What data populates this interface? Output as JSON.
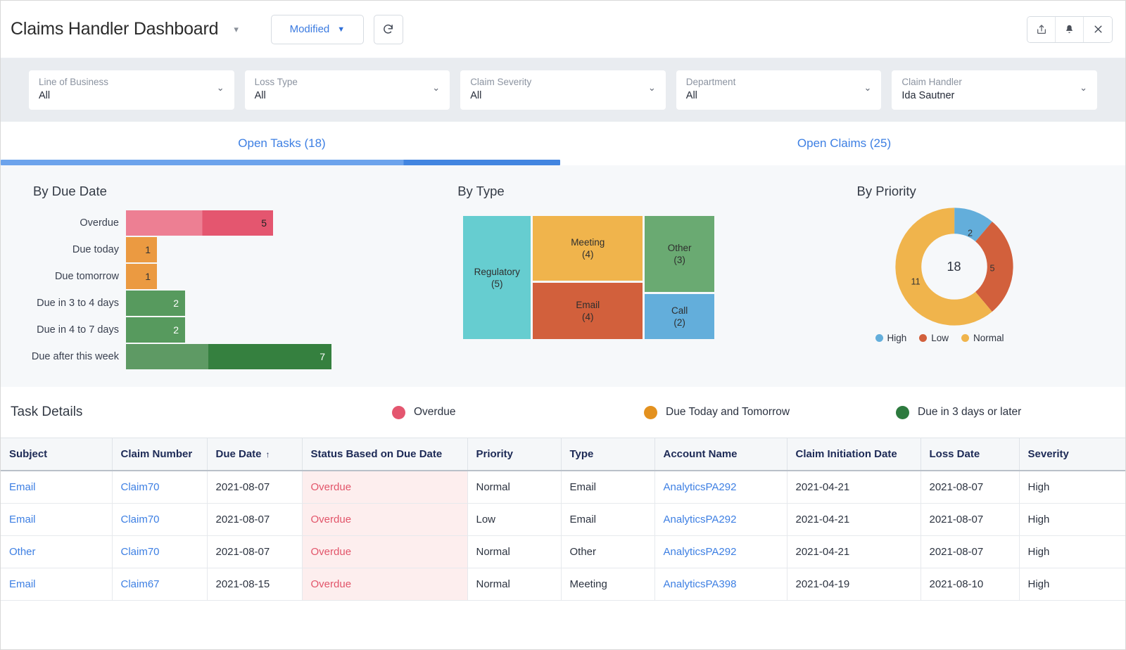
{
  "header": {
    "title": "Claims Handler Dashboard",
    "title_caret": "▾",
    "modified_label": "Modified",
    "modified_caret": "▼",
    "refresh_icon": "refresh-icon",
    "share_icon": "share-icon",
    "bell_icon": "bell-icon",
    "close_icon": "close-icon"
  },
  "filters": [
    {
      "label": "Line of Business",
      "value": "All"
    },
    {
      "label": "Loss Type",
      "value": "All"
    },
    {
      "label": "Claim Severity",
      "value": "All"
    },
    {
      "label": "Department",
      "value": "All"
    },
    {
      "label": "Claim Handler",
      "value": "Ida Sautner"
    }
  ],
  "tabs": [
    {
      "label": "Open Tasks (18)",
      "active": true
    },
    {
      "label": "Open Claims (25)",
      "active": false
    }
  ],
  "chart_data": [
    {
      "type": "bar",
      "title": "By Due Date",
      "orientation": "horizontal",
      "categories": [
        "Overdue",
        "Due today",
        "Due tomorrow",
        "Due in 3 to 4 days",
        "Due in 4 to 7 days",
        "Due after this week"
      ],
      "values": [
        5,
        1,
        1,
        2,
        2,
        7
      ],
      "colors": [
        "#e4566f",
        "#eb9a41",
        "#eb9a41",
        "#579a5e",
        "#579a5e",
        "#35803f"
      ],
      "xlabel": "",
      "ylabel": "",
      "xlim": [
        0,
        7
      ],
      "grid": false,
      "legend": "none"
    },
    {
      "type": "treemap",
      "title": "By Type",
      "categories": [
        "Regulatory",
        "Meeting",
        "Email",
        "Other",
        "Call"
      ],
      "values": [
        5,
        4,
        4,
        3,
        2
      ],
      "labels": [
        "Regulatory\n(5)",
        "Meeting\n(4)",
        "Email\n(4)",
        "Other\n(3)",
        "Call\n(2)"
      ],
      "colors": [
        "#66cdd0",
        "#f0b44c",
        "#d2603c",
        "#6aaa72",
        "#63aedb"
      ],
      "legend": "none"
    },
    {
      "type": "pie",
      "subtype": "donut",
      "title": "By Priority",
      "categories": [
        "High",
        "Low",
        "Normal"
      ],
      "values": [
        2,
        5,
        11
      ],
      "total": 18,
      "center_label": "18",
      "colors": [
        "#63aedb",
        "#d2603c",
        "#f0b44c"
      ],
      "legend": "bottom"
    }
  ],
  "chart_titles": {
    "due_date": "By Due Date",
    "type": "By Type",
    "priority": "By Priority"
  },
  "treemap_cells": [
    {
      "name": "Regulatory",
      "count": "(5)"
    },
    {
      "name": "Meeting",
      "count": "(4)"
    },
    {
      "name": "Email",
      "count": "(4)"
    },
    {
      "name": "Other",
      "count": "(3)"
    },
    {
      "name": "Call",
      "count": "(2)"
    }
  ],
  "donut": {
    "center": "18",
    "slice_labels": {
      "high": "2",
      "low": "5",
      "normal": "11"
    },
    "legend": [
      {
        "label": "High",
        "color": "#63aedb"
      },
      {
        "label": "Low",
        "color": "#d2603c"
      },
      {
        "label": "Normal",
        "color": "#f0b44c"
      }
    ]
  },
  "details": {
    "title": "Task Details",
    "legend": [
      {
        "label": "Overdue",
        "color": "#e4566f"
      },
      {
        "label": "Due Today and Tomorrow",
        "color": "#e3911f"
      },
      {
        "label": "Due in 3 days or later",
        "color": "#2d7a3e"
      }
    ],
    "columns": [
      "Subject",
      "Claim Number",
      "Due Date",
      "Status Based on Due Date",
      "Priority",
      "Type",
      "Account Name",
      "Claim Initiation Date",
      "Loss Date",
      "Severity"
    ],
    "sort_column": "Due Date",
    "sort_arrow": "↑",
    "rows": [
      {
        "subject": "Email",
        "claim_number": "Claim70",
        "due_date": "2021-08-07",
        "status": "Overdue",
        "priority": "Normal",
        "type": "Email",
        "account_name": "AnalyticsPA292",
        "claim_initiation_date": "2021-04-21",
        "loss_date": "2021-08-07",
        "severity": "High"
      },
      {
        "subject": "Email",
        "claim_number": "Claim70",
        "due_date": "2021-08-07",
        "status": "Overdue",
        "priority": "Low",
        "type": "Email",
        "account_name": "AnalyticsPA292",
        "claim_initiation_date": "2021-04-21",
        "loss_date": "2021-08-07",
        "severity": "High"
      },
      {
        "subject": "Other",
        "claim_number": "Claim70",
        "due_date": "2021-08-07",
        "status": "Overdue",
        "priority": "Normal",
        "type": "Other",
        "account_name": "AnalyticsPA292",
        "claim_initiation_date": "2021-04-21",
        "loss_date": "2021-08-07",
        "severity": "High"
      },
      {
        "subject": "Email",
        "claim_number": "Claim67",
        "due_date": "2021-08-15",
        "status": "Overdue",
        "priority": "Normal",
        "type": "Meeting",
        "account_name": "AnalyticsPA398",
        "claim_initiation_date": "2021-04-19",
        "loss_date": "2021-08-10",
        "severity": "High"
      }
    ]
  }
}
